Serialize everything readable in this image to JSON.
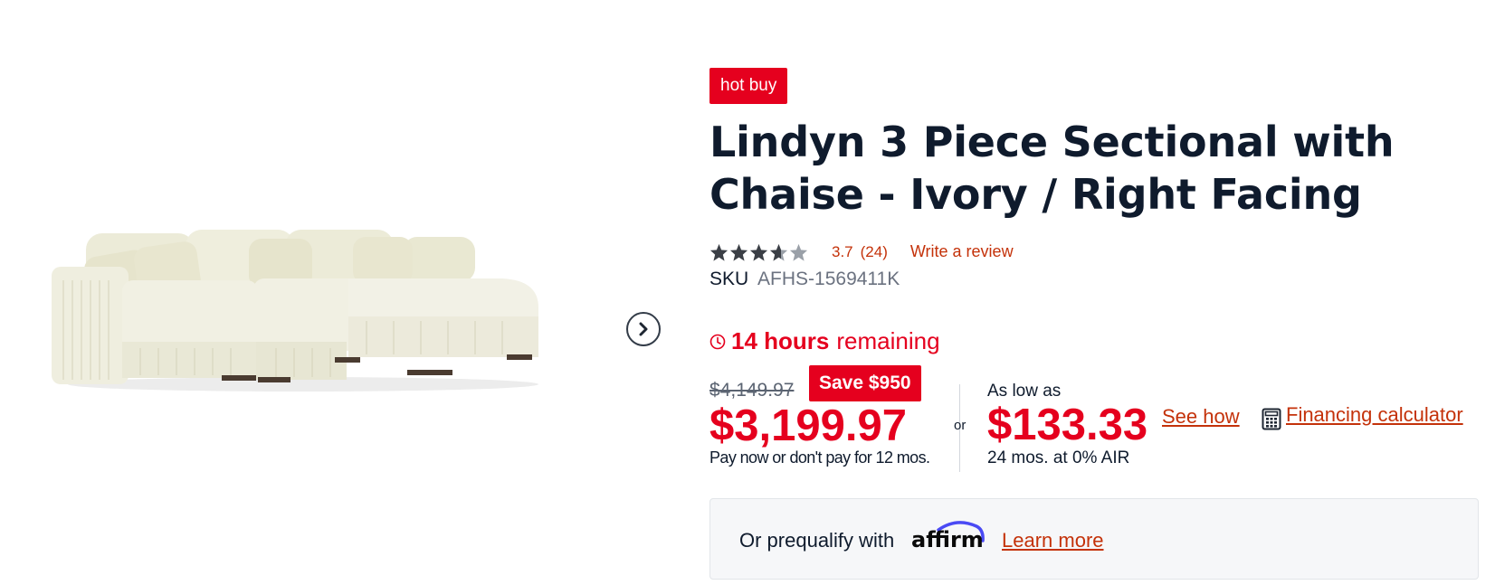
{
  "product": {
    "badge": "hot buy",
    "title": "Lindyn 3 Piece Sectional with Chaise - Ivory / Right Facing",
    "rating": 3.7,
    "rating_value": "3.7",
    "rating_count": "(24)",
    "write_review": "Write a review",
    "sku_label": "SKU",
    "sku_value": "AFHS-1569411K"
  },
  "timer": {
    "hours": "14 hours",
    "rest": "remaining"
  },
  "pricing": {
    "was_price": "$4,149.97",
    "save_label": "Save $950",
    "sale_price": "$3,199.97",
    "pay_note": "Pay now or don't pay for 12 mos.",
    "or": "or"
  },
  "financing": {
    "as_low_as": "As low as",
    "monthly": "$133.33",
    "terms": "24 mos. at 0% AIR",
    "see_how": "See how",
    "calculator": "Financing calculator"
  },
  "prequalify": {
    "text": "Or prequalify with",
    "brand": "affirm",
    "learn_more": "Learn more"
  },
  "colors": {
    "accent_red": "#e5001e",
    "link": "#c4320a",
    "text": "#0f1b2d"
  },
  "icons": [
    "chevron-right-icon",
    "star-icon",
    "clock-icon",
    "calculator-icon"
  ]
}
